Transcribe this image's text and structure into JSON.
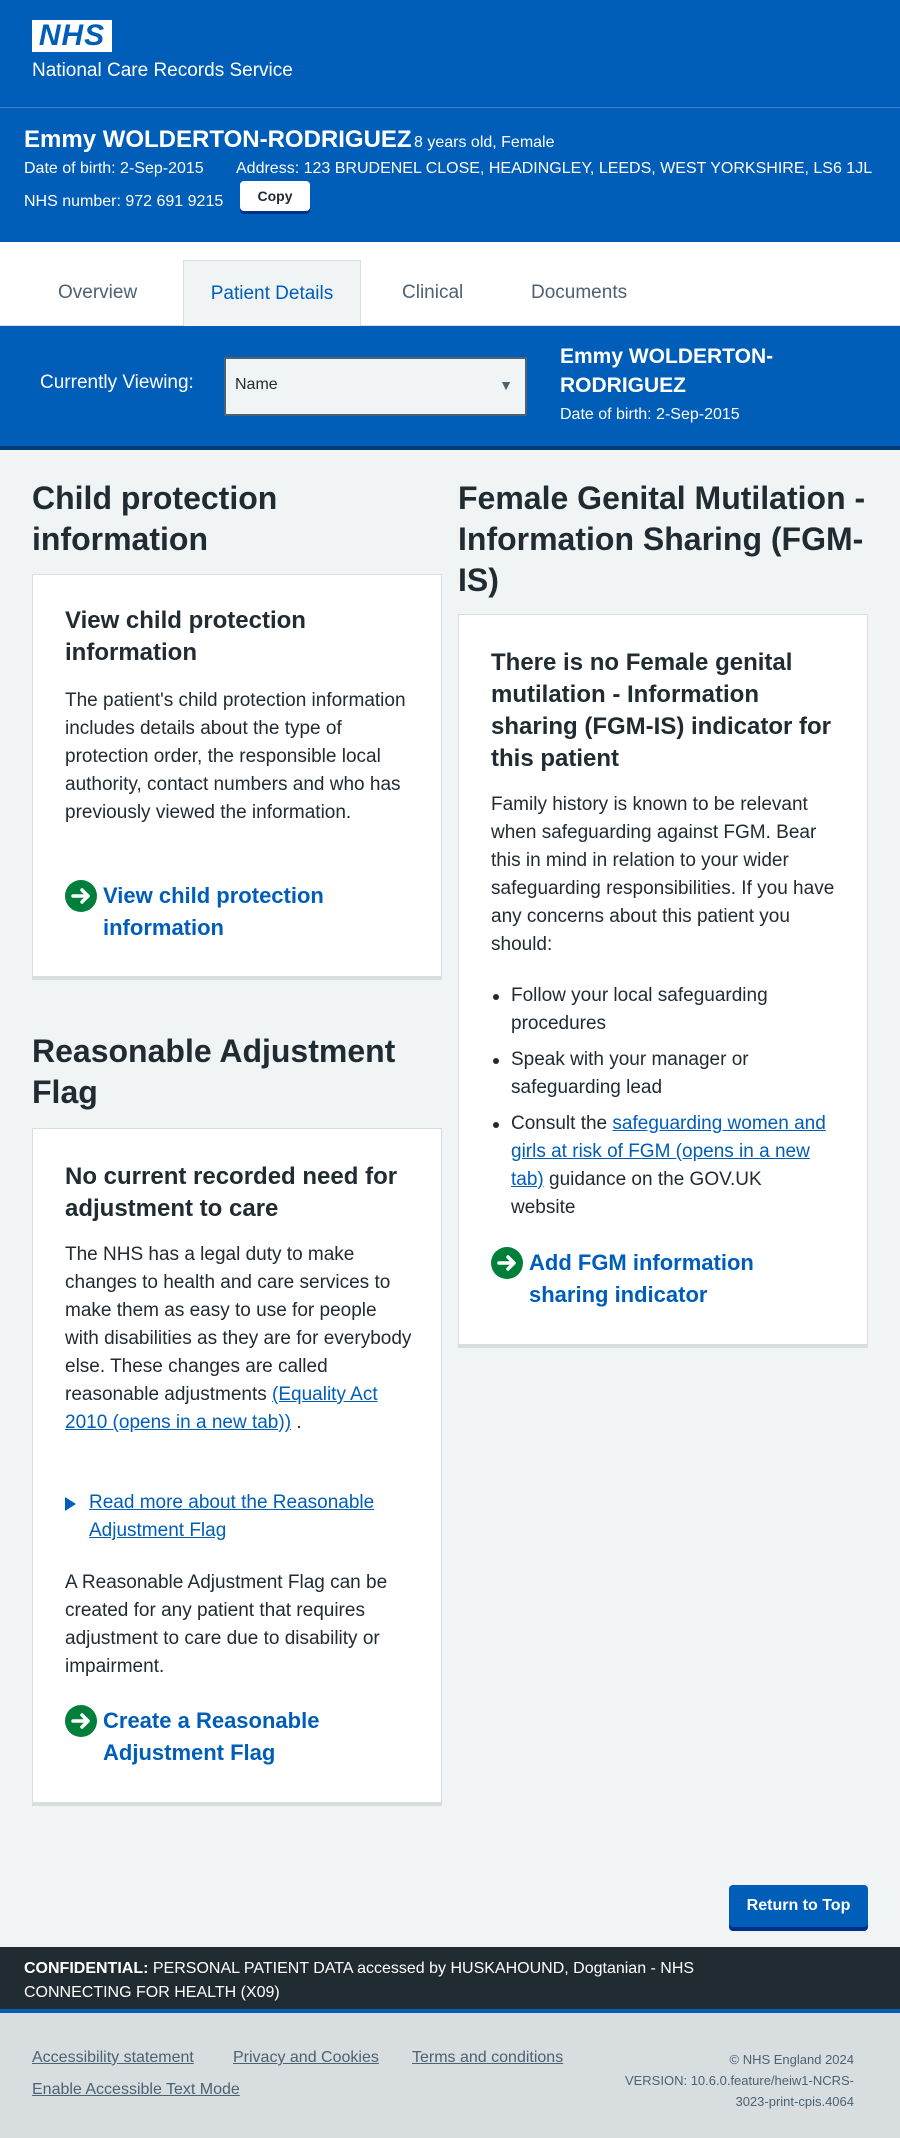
{
  "header": {
    "logo_text": "NHS",
    "service_name": "National Care Records Service"
  },
  "patient": {
    "name": "Emmy WOLDERTON-RODRIGUEZ",
    "age_gender": "8 years old, Female",
    "dob_label": "Date of birth: 2-Sep-2015",
    "address_label": "Address: 123 BRUDENEL CLOSE, HEADINGLEY, LEEDS, WEST YORKSHIRE, LS6 1JL",
    "nhs_number_label": "NHS number: 972 691 9215",
    "copy_label": "Copy"
  },
  "tabs": [
    {
      "label": "Overview",
      "active": false
    },
    {
      "label": "Patient Details",
      "active": true
    },
    {
      "label": "Clinical",
      "active": false
    },
    {
      "label": "Documents",
      "active": false
    }
  ],
  "viewing": {
    "label": "Currently Viewing:",
    "selected": "Name",
    "name_line1": "Emmy WOLDERTON-",
    "name_line2": "RODRIGUEZ",
    "dob": "Date of birth: 2-Sep-2015"
  },
  "child_protection": {
    "heading": "Child protection information",
    "card_title": "View child protection information",
    "body": "The patient's child protection information includes details about the type of protection order, the responsible local authority, contact numbers and who has previously viewed the information.",
    "action": "View child protection information"
  },
  "reasonable_adjustment": {
    "heading": "Reasonable Adjustment Flag",
    "card_title": "No current recorded need for adjustment to care",
    "body": "The NHS has a legal duty to make changes to health and care services to make them as easy to use for people with disabilities as they are for everybody else. These changes are called reasonable adjustments",
    "link": "(Equality Act 2010 (opens in a new tab))",
    "link_suffix": " .",
    "details_label": "Read more about the Reasonable Adjustment Flag",
    "body2": "A Reasonable Adjustment Flag can be created for any patient that requires adjustment to care due to disability or impairment.",
    "action": "Create a Reasonable Adjustment Flag"
  },
  "fgm": {
    "heading": "Female Genital Mutilation - Information Sharing (FGM-IS)",
    "card_title": "There is no Female genital mutilation - Information sharing (FGM-IS) indicator for this patient",
    "body": "Family history is known to be relevant when safeguarding against FGM. Bear this in mind in relation to your wider safeguarding responsibilities. If you have any concerns about this patient you should:",
    "list": [
      "Follow your local safeguarding procedures",
      "Speak with your manager or safeguarding lead"
    ],
    "list3_prefix": "Consult the ",
    "list3_link": "safeguarding women and girls at risk of FGM (opens in a new tab)",
    "list3_suffix": " guidance on the GOV.UK website",
    "action": "Add FGM information sharing indicator"
  },
  "return_top": "Return to Top",
  "confidential": {
    "label": "CONFIDENTIAL:",
    "text": " PERSONAL PATIENT DATA accessed by HUSKAHOUND, Dogtanian - NHS CONNECTING FOR HEALTH (X09)"
  },
  "footer": {
    "links": [
      "Accessibility statement",
      "Privacy and Cookies",
      "Terms and conditions",
      "Enable Accessible Text Mode"
    ],
    "copyright": "© NHS England 2024",
    "version": "VERSION: 10.6.0.feature/heiw1-NCRS-3023-print-cpis.4064"
  },
  "colors": {
    "nhs_blue": "#005eb8",
    "green_action": "#007f3b",
    "text": "#212b32",
    "background": "#f0f4f5"
  }
}
